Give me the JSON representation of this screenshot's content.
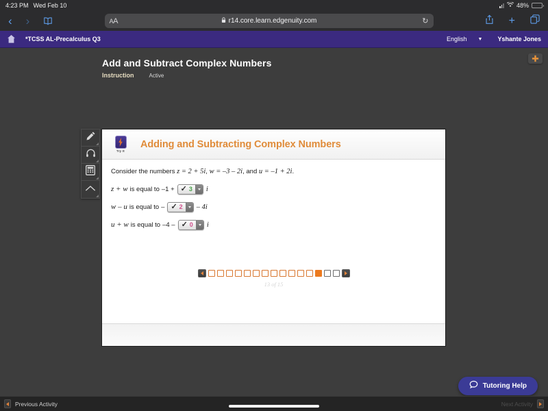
{
  "status_bar": {
    "time": "4:23 PM",
    "date": "Wed Feb 10",
    "battery_percent": "48%",
    "wifi_icon": "wifi-icon",
    "signal_icon": "cellular-signal-icon"
  },
  "browser": {
    "back_icon": "chevron-left-icon",
    "forward_icon": "chevron-right-icon",
    "bookmarks_icon": "book-icon",
    "reader_label_small": "A",
    "reader_label_large": "A",
    "lock_icon": "lock-icon",
    "url": "r14.core.learn.edgenuity.com",
    "reload_icon": "reload-icon",
    "share_icon": "share-icon",
    "new_tab_icon": "plus-icon",
    "tabs_icon": "tabs-icon"
  },
  "app_bar": {
    "home_icon": "home-icon",
    "course_title": "*TCSS AL-Precalculus Q3",
    "language": "English",
    "language_caret_icon": "chevron-down-icon",
    "user_name": "Yshante Jones"
  },
  "page": {
    "add_button_icon": "plus-icon",
    "lesson_title": "Add and Subtract Complex Numbers",
    "tabs": [
      {
        "label": "Instruction",
        "selected": true
      },
      {
        "label": "Active",
        "selected": false
      }
    ]
  },
  "tool_rail": [
    {
      "name": "pencil-tool",
      "icon": "pencil-icon"
    },
    {
      "name": "audio-tool",
      "icon": "headphones-icon"
    },
    {
      "name": "calculator-tool",
      "icon": "calculator-icon"
    },
    {
      "name": "collapse-tool",
      "icon": "chevron-up-icon"
    }
  ],
  "card": {
    "badge_label": "Try It",
    "badge_icon": "lightning-bolt-icon",
    "title": "Adding and Subtracting Complex Numbers",
    "prompt": {
      "lead": "Consider the numbers ",
      "z_def": "z = 2 + 5i",
      "sep1": ", ",
      "w_def": "w = –3 – 2i",
      "sep2": ", and ",
      "u_def": "u = –1 + 2i",
      "end": "."
    },
    "equations": [
      {
        "lhs": "z + w",
        "is_equal_to": "is equal to",
        "prefix": "–1 +",
        "answer": "3",
        "answer_color": "green",
        "check_icon": "checkmark-icon",
        "caret_icon": "caret-down-icon",
        "suffix": "i"
      },
      {
        "lhs": "w – u",
        "is_equal_to": "is equal to",
        "prefix": "–",
        "answer": "2",
        "answer_color": "pink",
        "check_icon": "checkmark-icon",
        "caret_icon": "caret-down-icon",
        "suffix": "– 4i"
      },
      {
        "lhs": "u + w",
        "is_equal_to": "is equal to",
        "prefix": "–4 –",
        "answer": "0",
        "answer_color": "pink",
        "check_icon": "checkmark-icon",
        "caret_icon": "caret-down-icon",
        "suffix": "i"
      }
    ]
  },
  "pager": {
    "prev_icon": "caret-left-icon",
    "next_icon": "caret-right-icon",
    "total": 15,
    "current": 13,
    "count_label": "13 of 15"
  },
  "tutoring": {
    "label": "Tutoring Help",
    "icon": "chat-bubble-icon"
  },
  "bottom_bar": {
    "prev_label": "Previous Activity",
    "prev_icon": "caret-left-icon",
    "next_label": "Next Activity",
    "next_icon": "caret-right-icon"
  },
  "colors": {
    "app_bar_purple": "#3b2a80",
    "accent_orange": "#e08c3a",
    "pager_orange": "#ec7a1e",
    "answer_green": "#49a049",
    "answer_pink": "#d14f8c",
    "tutor_blue": "#3b3b96"
  }
}
